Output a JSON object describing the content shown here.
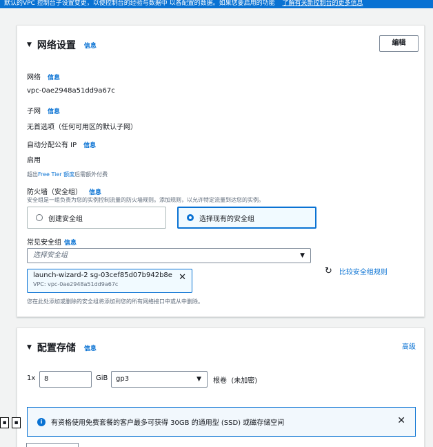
{
  "topbar": {
    "text": "默认的VPC 控制台子设置变更，以使控制台的经验与数据中 以各配置的数据。如果您要启用的功能",
    "link": "了解有关新控制台的更多信息"
  },
  "network": {
    "title": "网络设置",
    "info": "信息",
    "edit": "编辑",
    "network_label": "网络",
    "network_value": "vpc-0ae2948a51dd9a67c",
    "subnet_label": "子网",
    "subnet_value": "无首选项（任何可用区的默认子网）",
    "public_ip_label": "自动分配公有 IP",
    "public_ip_value": "启用",
    "free_tier_prefix": "超出",
    "free_tier_link": "Free Tier 额度",
    "free_tier_suffix": "后需额外付费",
    "firewall_label": "防火墙（安全组）",
    "firewall_desc": "安全组是一组负责为您的实例控制流量的防火墙规则。添加规则，以允许特定流量到达您的实例。",
    "option_create": "创建安全组",
    "option_existing": "选择现有的安全组",
    "common_sg_label": "常见安全组",
    "select_placeholder": "选择安全组",
    "token_name": "launch-wizard-2   sg-03cef85d07b942b8e",
    "token_vpc": "VPC: vpc-0ae2948a51dd9a67c",
    "compare_link": "比较安全组规则",
    "sg_note": "您在此处添加或删除的安全组将添加到您的所有网络接口中或从中删除。"
  },
  "storage": {
    "title": "配置存储",
    "info": "信息",
    "advanced": "高级",
    "count": "1x",
    "size": "8",
    "unit": "GiB",
    "volume_type": "gp3",
    "root_label": "根卷",
    "encryption": "(未加密)",
    "alert_text": "有资格使用免费套餐的客户最多可获得 30GB 的通用型 (SSD) 或磁存储空间"
  }
}
